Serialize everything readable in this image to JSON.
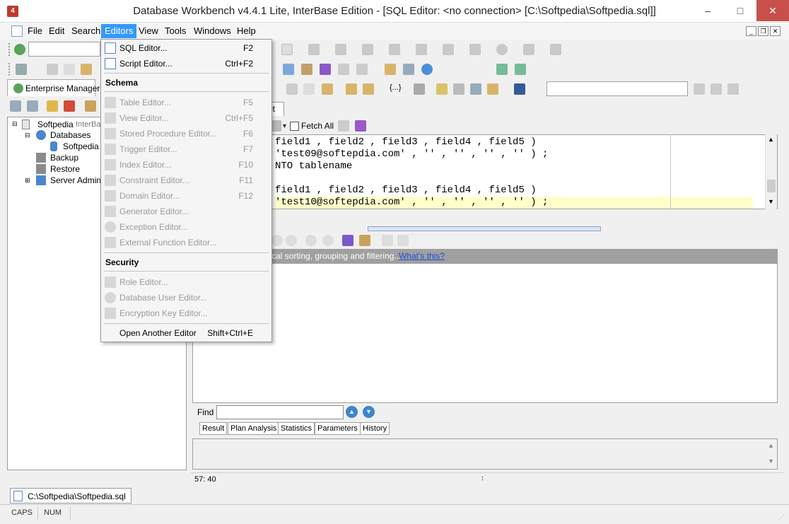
{
  "window": {
    "title": "Database Workbench v4.4.1 Lite, InterBase Edition - [SQL Editor: <no connection>  [C:\\Softpedia\\Softpedia.sql]]",
    "app_icon_text": "4",
    "controls": {
      "minimize": "–",
      "maximize": "□",
      "close": "✕"
    }
  },
  "menubar": {
    "items": [
      "File",
      "Edit",
      "Search",
      "Editors",
      "View",
      "Tools",
      "Windows",
      "Help"
    ],
    "active": "Editors"
  },
  "left_panel": {
    "tab_label": "Enterprise Manager",
    "tree": {
      "root": "Softpedia",
      "root_suffix": "InterBa",
      "databases": "Databases",
      "database_child": "Softpedia",
      "backup": "Backup",
      "restore": "Restore",
      "server_admin": "Server Adminis"
    }
  },
  "editors_menu": {
    "items": [
      {
        "label": "SQL Editor...",
        "shortcut": "F2",
        "enabled": true,
        "icon": "sql-editor-icon"
      },
      {
        "label": "Script Editor...",
        "shortcut": "Ctrl+F2",
        "enabled": true,
        "icon": "script-editor-icon"
      }
    ],
    "schema_header": "Schema",
    "schema_items": [
      {
        "label": "Table Editor...",
        "shortcut": "F5",
        "icon": "table-icon"
      },
      {
        "label": "View Editor...",
        "shortcut": "Ctrl+F5",
        "icon": "view-icon"
      },
      {
        "label": "Stored Procedure Editor...",
        "shortcut": "F6",
        "icon": "procedure-icon"
      },
      {
        "label": "Trigger Editor...",
        "shortcut": "F7",
        "icon": "trigger-icon"
      },
      {
        "label": "Index Editor...",
        "shortcut": "F10",
        "icon": "index-icon"
      },
      {
        "label": "Constraint Editor...",
        "shortcut": "F11",
        "icon": "constraint-icon"
      },
      {
        "label": "Domain Editor...",
        "shortcut": "F12",
        "icon": "domain-icon"
      },
      {
        "label": "Generator Editor...",
        "shortcut": "",
        "icon": "generator-icon"
      },
      {
        "label": "Exception Editor...",
        "shortcut": "",
        "icon": "exception-icon"
      },
      {
        "label": "External Function Editor...",
        "shortcut": "",
        "icon": "external-function-icon"
      }
    ],
    "security_header": "Security",
    "security_items": [
      {
        "label": "Role Editor...",
        "shortcut": "",
        "icon": "role-icon"
      },
      {
        "label": "Database User Editor...",
        "shortcut": "",
        "icon": "user-icon"
      },
      {
        "label": "Encryption Key Editor...",
        "shortcut": "",
        "icon": "key-icon"
      }
    ],
    "footer_item": {
      "label": "Open Another Editor",
      "shortcut": "Shift+Ctrl+E"
    }
  },
  "editor": {
    "tab_label": "pt",
    "fetch_all_label": "Fetch All",
    "sql_lines": [
      "field1 , field2 , field3 , field4 , field5 )",
      "'test09@softepdia.com' , '' , '' , '' , '' ) ;",
      "NTO tablename",
      "",
      "field1 , field2 , field3 , field4 , field5 )",
      "'test10@softepdia.com' , '' , '' , '' , '' ) ;"
    ],
    "grouping_text": "cal sorting, grouping and filtering...",
    "grouping_link": "What's this?",
    "find_label": "Find",
    "result_tabs": [
      "Result",
      "Plan Analysis",
      "Statistics",
      "Parameters",
      "History"
    ],
    "cursor_position": "57:  40"
  },
  "document_tab": "C:\\Softpedia\\Softpedia.sql",
  "statusbar": {
    "caps": "CAPS",
    "num": "NUM"
  }
}
